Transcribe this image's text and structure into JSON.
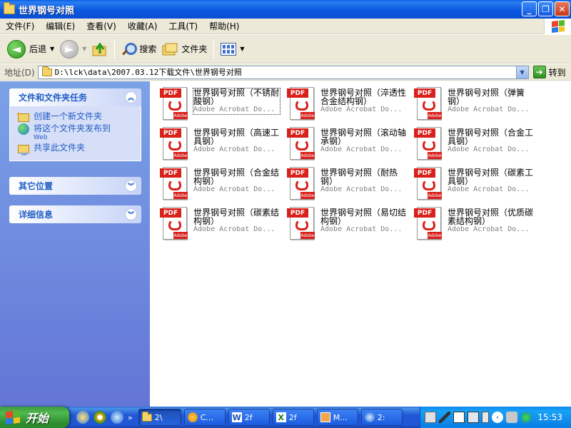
{
  "window": {
    "title": "世界钢号对照",
    "buttons": {
      "minimize": "_",
      "maximize": "❐",
      "close": "✕"
    }
  },
  "menu": [
    "文件(F)",
    "编辑(E)",
    "查看(V)",
    "收藏(A)",
    "工具(T)",
    "帮助(H)"
  ],
  "toolbar": {
    "back_label": "后退",
    "search_label": "搜索",
    "folders_label": "文件夹"
  },
  "address": {
    "label": "地址(D)",
    "path": "D:\\lck\\data\\2007.03.12下载文件\\世界钢号对照",
    "go_label": "转到"
  },
  "tasks": {
    "header": "文件和文件夹任务",
    "items": [
      {
        "label": "创建一个新文件夹",
        "sub": ""
      },
      {
        "label": "将这个文件夹发布到",
        "sub": "Web"
      },
      {
        "label": "共享此文件夹",
        "sub": ""
      }
    ]
  },
  "other_places": {
    "header": "其它位置"
  },
  "details": {
    "header": "详细信息"
  },
  "icon": {
    "tag": "PDF",
    "brand": "Adobe"
  },
  "files": [
    {
      "name": "世界钢号对照（不锈耐酸钢）",
      "type": "Adobe Acrobat Do..."
    },
    {
      "name": "世界钢号对照（淬透性合金结构钢）",
      "type": "Adobe Acrobat Do..."
    },
    {
      "name": "世界钢号对照（弹簧钢）",
      "type": "Adobe Acrobat Do..."
    },
    {
      "name": "世界钢号对照（高速工具钢）",
      "type": "Adobe Acrobat Do..."
    },
    {
      "name": "世界钢号对照（滚动轴承钢）",
      "type": "Adobe Acrobat Do..."
    },
    {
      "name": "世界钢号对照（合金工具钢）",
      "type": "Adobe Acrobat Do..."
    },
    {
      "name": "世界钢号对照（合金结构钢）",
      "type": "Adobe Acrobat Do..."
    },
    {
      "name": "世界钢号对照（耐热钢）",
      "type": "Adobe Acrobat Do..."
    },
    {
      "name": "世界钢号对照（碳素工具钢）",
      "type": "Adobe Acrobat Do..."
    },
    {
      "name": "世界钢号对照（碳素结构钢）",
      "type": "Adobe Acrobat Do..."
    },
    {
      "name": "世界钢号对照（易切结构钢）",
      "type": "Adobe Acrobat Do..."
    },
    {
      "name": "世界钢号对照（优质碳素结构钢）",
      "type": "Adobe Acrobat Do..."
    }
  ],
  "taskbar": {
    "start_label": "开始",
    "items": [
      "2\\",
      "C...",
      "2f",
      "2f",
      "M...",
      "2:"
    ],
    "clock": "15:53"
  },
  "colors": {
    "titlebar": "#0a58e0",
    "taskpane": "#6f8fe0",
    "accent_link": "#215dc6",
    "pdf_red": "#d8211b"
  }
}
